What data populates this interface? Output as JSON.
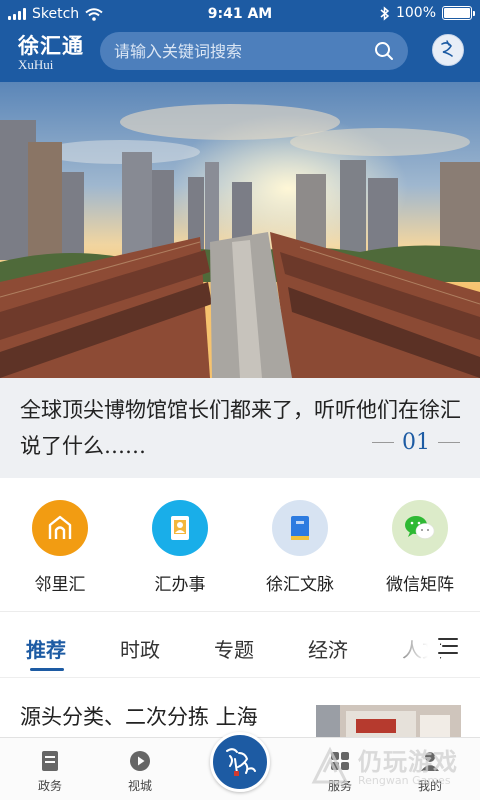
{
  "status_bar": {
    "carrier": "Sketch",
    "time": "9:41 AM",
    "battery": "100%"
  },
  "header": {
    "brand_cn": "徐汇通",
    "brand_en": "XuHui",
    "search_placeholder": "请输入关键词搜索",
    "color": "#1d5ba3"
  },
  "hero": {
    "headline": "全球顶尖博物馆馆长们都来了，听听他们在徐汇说了什么……",
    "page_number": "01"
  },
  "shortcuts": [
    {
      "label": "邻里汇",
      "icon": "neighborhood-icon",
      "color": "#f29c12"
    },
    {
      "label": "汇办事",
      "icon": "id-card-icon",
      "color": "#19aee9"
    },
    {
      "label": "徐汇文脉",
      "icon": "book-icon",
      "color": "#d7e3f2"
    },
    {
      "label": "微信矩阵",
      "icon": "wechat-icon",
      "color": "#dcebc9"
    }
  ],
  "tabs": [
    "推荐",
    "时政",
    "专题",
    "经济",
    "人文"
  ],
  "active_tab": "推荐",
  "article": {
    "title": "源头分类、二次分拣 上海"
  },
  "bottom_nav": {
    "items": [
      {
        "label": "政务",
        "icon": "document-icon"
      },
      {
        "label": "视城",
        "icon": "play-icon"
      },
      {
        "label": "服务",
        "icon": "grid-icon"
      },
      {
        "label": "我的",
        "icon": "user-icon"
      }
    ],
    "center_label": "徐汇"
  },
  "watermark": {
    "cn": "仍玩游戏",
    "en": "Rengwan Games"
  }
}
